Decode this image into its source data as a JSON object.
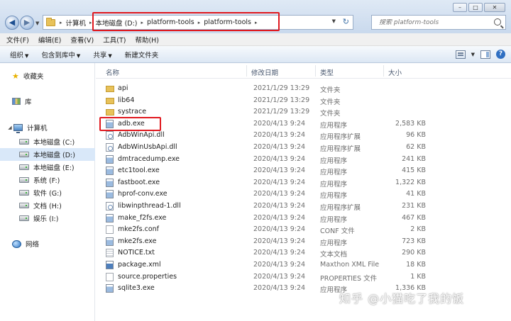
{
  "window": {
    "controls": {
      "minimize": "–",
      "maximize": "□",
      "close": "✕"
    }
  },
  "navigation": {
    "back": "◀",
    "forward": "▶"
  },
  "address": {
    "segments": [
      "计算机",
      "本地磁盘 (D:)",
      "platform-tools",
      "platform-tools"
    ],
    "refresh_symbol": "↻"
  },
  "search": {
    "placeholder": "搜索 platform-tools"
  },
  "menu": [
    "文件(F)",
    "编辑(E)",
    "查看(V)",
    "工具(T)",
    "帮助(H)"
  ],
  "toolbar": {
    "organize": "组织",
    "include_in_library": "包含到库中",
    "share": "共享",
    "new_folder": "新建文件夹",
    "help": "?"
  },
  "sidebar": {
    "favorites": "收藏夹",
    "libraries": "库",
    "computer": "计算机",
    "drives": [
      "本地磁盘 (C:)",
      "本地磁盘 (D:)",
      "本地磁盘 (E:)",
      "系统 (F:)",
      "软件 (G:)",
      "文档 (H:)",
      "娱乐 (I:)"
    ],
    "selected_drive_index": 1,
    "network": "网络"
  },
  "columns": {
    "name": "名称",
    "date": "修改日期",
    "type": "类型",
    "size": "大小"
  },
  "files": [
    {
      "name": "api",
      "date": "2021/1/29 13:29",
      "type": "文件夹",
      "size": "",
      "icon": "folder-icon"
    },
    {
      "name": "lib64",
      "date": "2021/1/29 13:29",
      "type": "文件夹",
      "size": "",
      "icon": "folder-icon"
    },
    {
      "name": "systrace",
      "date": "2021/1/29 13:29",
      "type": "文件夹",
      "size": "",
      "icon": "folder-icon"
    },
    {
      "name": "adb.exe",
      "date": "2020/4/13 9:24",
      "type": "应用程序",
      "size": "2,583 KB",
      "icon": "exe-icon"
    },
    {
      "name": "AdbWinApi.dll",
      "date": "2020/4/13 9:24",
      "type": "应用程序扩展",
      "size": "96 KB",
      "icon": "dll-icon"
    },
    {
      "name": "AdbWinUsbApi.dll",
      "date": "2020/4/13 9:24",
      "type": "应用程序扩展",
      "size": "62 KB",
      "icon": "dll-icon"
    },
    {
      "name": "dmtracedump.exe",
      "date": "2020/4/13 9:24",
      "type": "应用程序",
      "size": "241 KB",
      "icon": "exe-icon"
    },
    {
      "name": "etc1tool.exe",
      "date": "2020/4/13 9:24",
      "type": "应用程序",
      "size": "415 KB",
      "icon": "exe-icon"
    },
    {
      "name": "fastboot.exe",
      "date": "2020/4/13 9:24",
      "type": "应用程序",
      "size": "1,322 KB",
      "icon": "exe-icon"
    },
    {
      "name": "hprof-conv.exe",
      "date": "2020/4/13 9:24",
      "type": "应用程序",
      "size": "41 KB",
      "icon": "exe-icon"
    },
    {
      "name": "libwinpthread-1.dll",
      "date": "2020/4/13 9:24",
      "type": "应用程序扩展",
      "size": "231 KB",
      "icon": "dll-icon"
    },
    {
      "name": "make_f2fs.exe",
      "date": "2020/4/13 9:24",
      "type": "应用程序",
      "size": "467 KB",
      "icon": "exe-icon"
    },
    {
      "name": "mke2fs.conf",
      "date": "2020/4/13 9:24",
      "type": "CONF 文件",
      "size": "2 KB",
      "icon": "doc-icon"
    },
    {
      "name": "mke2fs.exe",
      "date": "2020/4/13 9:24",
      "type": "应用程序",
      "size": "723 KB",
      "icon": "exe-icon"
    },
    {
      "name": "NOTICE.txt",
      "date": "2020/4/13 9:24",
      "type": "文本文档",
      "size": "290 KB",
      "icon": "txt-icon"
    },
    {
      "name": "package.xml",
      "date": "2020/4/13 9:24",
      "type": "Maxthon XML File",
      "size": "18 KB",
      "icon": "xml-icon"
    },
    {
      "name": "source.properties",
      "date": "2020/4/13 9:24",
      "type": "PROPERTIES 文件",
      "size": "1 KB",
      "icon": "doc-icon"
    },
    {
      "name": "sqlite3.exe",
      "date": "2020/4/13 9:24",
      "type": "应用程序",
      "size": "1,336 KB",
      "icon": "exe-icon"
    }
  ],
  "watermark": "知乎 @小猫吃了我的饭",
  "colors": {
    "highlight": "#e0191f",
    "selection": "#d9e8f9",
    "folder": "#e8c25a"
  }
}
